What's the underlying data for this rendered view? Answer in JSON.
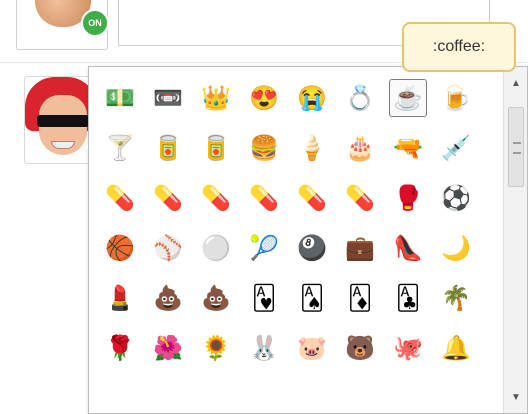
{
  "tooltip": {
    "text": ":coffee:"
  },
  "top_avatar": {
    "status_badge": "ON"
  },
  "emoji_picker": {
    "rows": [
      [
        "💵",
        "📼",
        "👑",
        "😍",
        "😭",
        "💍",
        "☕",
        "🍺"
      ],
      [
        "🍸",
        "🥫",
        "🥫",
        "🍔",
        "🍦",
        "🎂",
        "🔫",
        "💉"
      ],
      [
        "💊",
        "💊",
        "💊",
        "💊",
        "💊",
        "💊",
        "🥊",
        "⚽"
      ],
      [
        "🏀",
        "⚾",
        "⚪",
        "🎾",
        "🎱",
        "💼",
        "👠",
        "🌙"
      ],
      [
        "💄",
        "💩",
        "💩",
        "🂱",
        "🂡",
        "🃁",
        "🃑",
        "🌴"
      ],
      [
        "🌹",
        "🌺",
        "🌻",
        "🐰",
        "🐷",
        "🐻",
        "🐙",
        "🔔"
      ]
    ],
    "selected_index": [
      0,
      6
    ]
  }
}
